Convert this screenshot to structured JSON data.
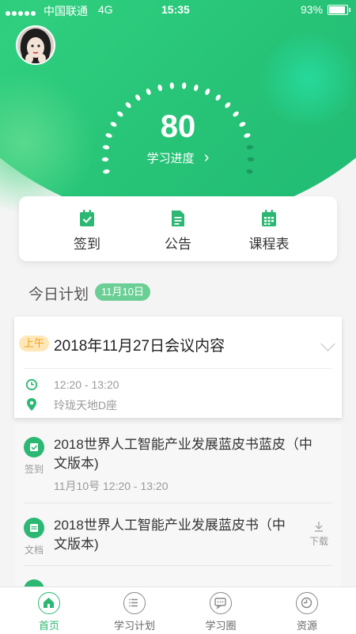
{
  "status_bar": {
    "carrier": "中国联通",
    "network": "4G",
    "time": "15:35",
    "battery": "93%"
  },
  "progress": {
    "score": "80",
    "label": "学习进度",
    "arrow": "›"
  },
  "quick_actions": [
    {
      "label": "签到",
      "icon": "checkin-icon"
    },
    {
      "label": "公告",
      "icon": "notice-icon"
    },
    {
      "label": "课程表",
      "icon": "calendar-icon"
    }
  ],
  "today": {
    "title": "今日计划",
    "date_badge": "11月10日"
  },
  "expanded_plan": {
    "period_tag": "上午",
    "title": "2018年11月27日会议内容",
    "time": "12:20 - 13:20",
    "location": "玲珑天地D座"
  },
  "plan_items": [
    {
      "type_label": "签到",
      "title_line1": "2018世界人工智能产业发展蓝皮书蓝皮（中",
      "title_line2": "文版本)",
      "subtitle": "11月10号 12:20 - 13:20"
    },
    {
      "type_label": "文档",
      "title_line1": "2018世界人工智能产业发展蓝皮书（中",
      "title_line2": "文版本)",
      "action": "下载"
    }
  ],
  "tabs": [
    {
      "label": "首页",
      "active": true
    },
    {
      "label": "学习计划",
      "active": false
    },
    {
      "label": "学习圈",
      "active": false
    },
    {
      "label": "资源",
      "active": false
    }
  ],
  "colors": {
    "accent": "#2cb873",
    "badge": "#6bcf95",
    "am_tag_bg": "#ffe7b8",
    "am_tag_text": "#f0a020"
  }
}
